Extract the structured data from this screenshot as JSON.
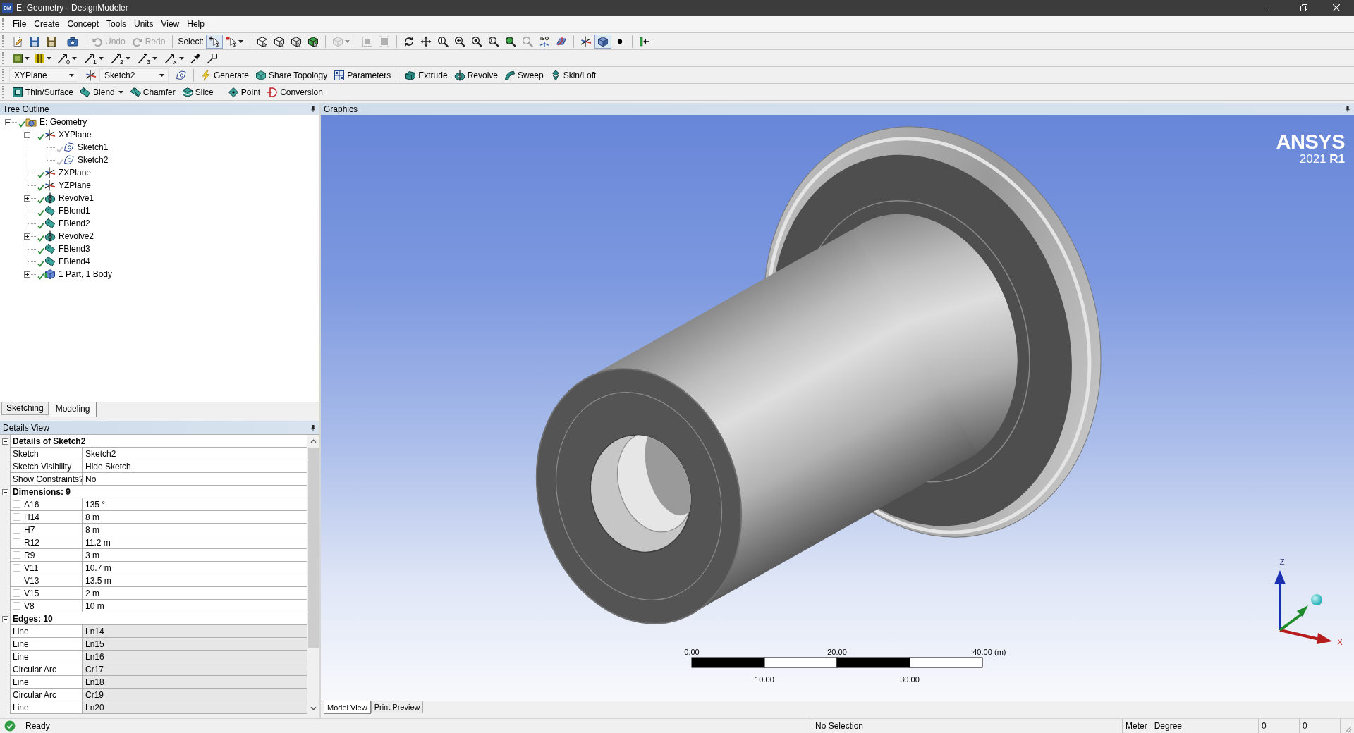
{
  "window": {
    "app_icon": "DM",
    "title": "E: Geometry - DesignModeler"
  },
  "menu": [
    "File",
    "Create",
    "Concept",
    "Tools",
    "Units",
    "View",
    "Help"
  ],
  "toolbar_1": {
    "undo": {
      "label": "Undo",
      "disabled": true
    },
    "redo": {
      "label": "Redo",
      "disabled": true
    },
    "select_label": "Select:",
    "select_modes": [
      {
        "selected": true
      },
      {
        "selected": false
      }
    ],
    "box_tools": [
      {
        "disabled": true
      },
      {
        "disabled": true
      },
      {
        "disabled": true
      }
    ],
    "iso_label": "ISO",
    "shaded": {
      "pressed": true
    }
  },
  "toolbar_2": {
    "line_tools": [
      "0",
      "1",
      "2",
      "3",
      "x"
    ]
  },
  "toolbar_3": {
    "plane": "XYPlane",
    "sketch": "Sketch2",
    "groups": [
      [
        "Generate",
        "Share Topology",
        "Parameters"
      ],
      [
        "Extrude",
        "Revolve",
        "Sweep",
        "Skin/Loft"
      ]
    ]
  },
  "toolbar_4": {
    "groups": [
      [
        "Thin/Surface",
        "Blend",
        "Chamfer",
        "Slice"
      ],
      [
        "Point",
        "Conversion"
      ]
    ]
  },
  "tree_outline": {
    "title": "Tree Outline",
    "items": [
      {
        "label": "E: Geometry",
        "kind": "geometry",
        "up_to_date": true,
        "expanded": true,
        "children": [
          {
            "label": "XYPlane",
            "kind": "plane",
            "up_to_date": true,
            "expanded": true,
            "children": [
              {
                "label": "Sketch1",
                "kind": "sketch",
                "up_to_date": false
              },
              {
                "label": "Sketch2",
                "kind": "sketch",
                "up_to_date": false
              }
            ]
          },
          {
            "label": "ZXPlane",
            "kind": "plane",
            "up_to_date": true
          },
          {
            "label": "YZPlane",
            "kind": "plane",
            "up_to_date": true
          },
          {
            "label": "Revolve1",
            "kind": "revolve",
            "up_to_date": true,
            "expanded": false
          },
          {
            "label": "FBlend1",
            "kind": "blend",
            "up_to_date": true
          },
          {
            "label": "FBlend2",
            "kind": "blend",
            "up_to_date": true
          },
          {
            "label": "Revolve2",
            "kind": "revolve",
            "up_to_date": true,
            "expanded": false
          },
          {
            "label": "FBlend3",
            "kind": "blend",
            "up_to_date": true
          },
          {
            "label": "FBlend4",
            "kind": "blend",
            "up_to_date": true
          },
          {
            "label": "1 Part, 1 Body",
            "kind": "body",
            "up_to_date": true,
            "expanded": false
          }
        ]
      }
    ]
  },
  "panel_tabs": [
    {
      "label": "Sketching",
      "selected": false
    },
    {
      "label": "Modeling",
      "selected": true
    }
  ],
  "details_view": {
    "title": "Details View",
    "groups": [
      {
        "title": "Details of Sketch2",
        "expanded": true,
        "rows": [
          {
            "kind": "field",
            "label": "Sketch",
            "value": "Sketch2"
          },
          {
            "kind": "field",
            "label": "Sketch Visibility",
            "value": "Hide Sketch"
          },
          {
            "kind": "field",
            "label": "Show Constraints?",
            "value": "No"
          }
        ]
      },
      {
        "title": "Dimensions: 9",
        "expanded": true,
        "rows": [
          {
            "kind": "dimension",
            "label": "A16",
            "value": "135 °",
            "checked": false
          },
          {
            "kind": "dimension",
            "label": "H14",
            "value": "8 m",
            "checked": false
          },
          {
            "kind": "dimension",
            "label": "H7",
            "value": "8 m",
            "checked": false
          },
          {
            "kind": "dimension",
            "label": "R12",
            "value": "11.2 m",
            "checked": false
          },
          {
            "kind": "dimension",
            "label": "R9",
            "value": "3 m",
            "checked": false
          },
          {
            "kind": "dimension",
            "label": "V11",
            "value": "10.7 m",
            "checked": false
          },
          {
            "kind": "dimension",
            "label": "V13",
            "value": "13.5 m",
            "checked": false
          },
          {
            "kind": "dimension",
            "label": "V15",
            "value": "2 m",
            "checked": false
          },
          {
            "kind": "dimension",
            "label": "V8",
            "value": "10 m",
            "checked": false
          }
        ]
      },
      {
        "title": "Edges: 10",
        "expanded": true,
        "rows": [
          {
            "kind": "readonly",
            "label": "Line",
            "value": "Ln14"
          },
          {
            "kind": "readonly",
            "label": "Line",
            "value": "Ln15"
          },
          {
            "kind": "readonly",
            "label": "Line",
            "value": "Ln16"
          },
          {
            "kind": "readonly",
            "label": "Circular Arc",
            "value": "Cr17"
          },
          {
            "kind": "readonly",
            "label": "Line",
            "value": "Ln18"
          },
          {
            "kind": "readonly",
            "label": "Circular Arc",
            "value": "Cr19"
          },
          {
            "kind": "readonly",
            "label": "Line",
            "value": "Ln20"
          }
        ]
      }
    ]
  },
  "graphics": {
    "title": "Graphics",
    "logo": {
      "name": "ANSYS",
      "version": "2021 **R1**"
    },
    "scale_bar": {
      "labels": [
        "0.00",
        "10.00",
        "20.00",
        "30.00",
        "40.00"
      ],
      "unit": "(m)"
    },
    "triad": {
      "z": "Z",
      "x": "X"
    },
    "tabs": [
      {
        "label": "Model View",
        "selected": true
      },
      {
        "label": "Print Preview",
        "selected": false
      }
    ]
  },
  "status_bar": {
    "message": "Ready",
    "selection": "No Selection",
    "length_unit": "Meter",
    "angle_unit": "Degree",
    "fields": [
      "0",
      "0"
    ]
  }
}
